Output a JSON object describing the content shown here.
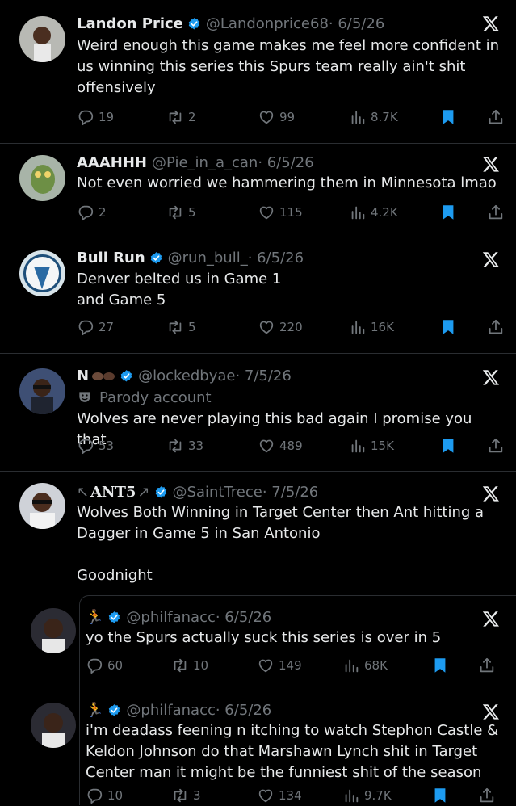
{
  "tweets": [
    {
      "name": "Landon Price",
      "verified": true,
      "handle": "@Landonprice68",
      "date": "· 6/5/26",
      "text": "Weird enough this game makes me feel more confident in us winning this series this Spurs team really ain't shit offensively",
      "replies": "19",
      "retweets": "2",
      "likes": "99",
      "views": "8.7K"
    },
    {
      "name": "AAAHHH",
      "verified": false,
      "handle": "@Pie_in_a_can",
      "date": "· 6/5/26",
      "text": "Not even worried we hammering them in Minnesota lmao",
      "replies": "2",
      "retweets": "5",
      "likes": "115",
      "views": "4.2K"
    },
    {
      "name": "Bull Run",
      "verified": true,
      "handle": "@run_bull_",
      "date": "· 6/5/26",
      "text_line1": "Denver belted us in Game 1",
      "text_line2": "and Game 5",
      "replies": "27",
      "retweets": "5",
      "likes": "220",
      "views": "16K"
    },
    {
      "name": "N",
      "verified": true,
      "handle": "@lockedbyae",
      "date": "· 7/5/26",
      "parody": "Parody account",
      "text": "Wolves are never playing this bad again I promise you that",
      "replies": "53",
      "retweets": "33",
      "likes": "489",
      "views": "15K"
    },
    {
      "name": "ANT5",
      "verified": true,
      "handle": "@SaintTrece",
      "date": "· 7/5/26",
      "text": "Wolves Both Winning in Target Center then Ant hitting a Dagger in Game 5 in San Antonio",
      "text2": "Goodnight"
    }
  ],
  "quotes": [
    {
      "name": "",
      "verified": true,
      "handle": "@philfanacc",
      "date": "· 6/5/26",
      "text": "yo the Spurs actually suck this series is over in 5",
      "replies": "60",
      "retweets": "10",
      "likes": "149",
      "views": "68K"
    },
    {
      "name": "",
      "verified": true,
      "handle": "@philfanacc",
      "date": "· 6/5/26",
      "text": "i'm deadass feening n itching to watch Stephon Castle & Keldon Johnson do that Marshawn Lynch shit in Target Center man it might be the funniest shit of the season",
      "replies": "10",
      "retweets": "3",
      "likes": "134",
      "views": "9.7K"
    }
  ],
  "colors": {
    "background": "#000000",
    "text": "#e7e9ea",
    "muted": "#71767b",
    "accent": "#1d9bf0"
  }
}
